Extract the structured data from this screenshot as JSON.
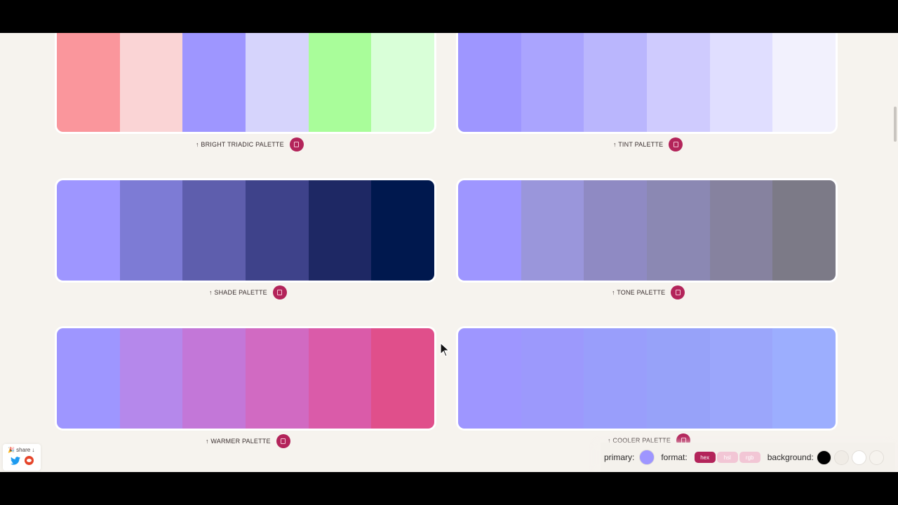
{
  "palettes": [
    {
      "label": "↑ BRIGHT TRIADIC PALETTE",
      "colors": [
        "#fa969c",
        "#fad4d5",
        "#9e96ff",
        "#d6d4fc",
        "#a9fd9a",
        "#d9ffd8"
      ]
    },
    {
      "label": "↑ TINT PALETTE",
      "colors": [
        "#9e96ff",
        "#aaa4fe",
        "#bab6fd",
        "#cfcbfe",
        "#e0deff",
        "#f2f1fd"
      ]
    },
    {
      "label": "↑ SHADE PALETTE",
      "colors": [
        "#9e96ff",
        "#7d7bd5",
        "#5e5ead",
        "#3e428a",
        "#1e2864",
        "#00184e"
      ]
    },
    {
      "label": "↑ TONE PALETTE",
      "colors": [
        "#9e96ff",
        "#9a96db",
        "#8f8ac3",
        "#8b88b3",
        "#86829f",
        "#7c7a87"
      ]
    },
    {
      "label": "↑ WARMER PALETTE",
      "colors": [
        "#9e96ff",
        "#b588eb",
        "#c377d8",
        "#d16ac2",
        "#da5ba9",
        "#e04f8b"
      ]
    },
    {
      "label": "↑ COOLER PALETTE",
      "colors": [
        "#9e96ff",
        "#9c99fc",
        "#999efb",
        "#97a2f9",
        "#9ba6fb",
        "#9caefe"
      ]
    }
  ],
  "share": {
    "label": "🎉 share ↓"
  },
  "settings": {
    "primary_label": "primary:",
    "primary_color": "#9e96ff",
    "format_label": "format:",
    "formats": [
      "hex",
      "hsl",
      "rgb"
    ],
    "selected_format": "hex",
    "background_label": "background:",
    "backgrounds": [
      "#000000",
      "#f0ece6",
      "#ffffff",
      "#f6f3ee"
    ]
  },
  "colors": {
    "accent": "#b3245a",
    "page_bg": "#f6f3ee"
  },
  "icons": [
    "copy-icon",
    "twitter-icon",
    "reddit-icon",
    "cursor-icon"
  ]
}
